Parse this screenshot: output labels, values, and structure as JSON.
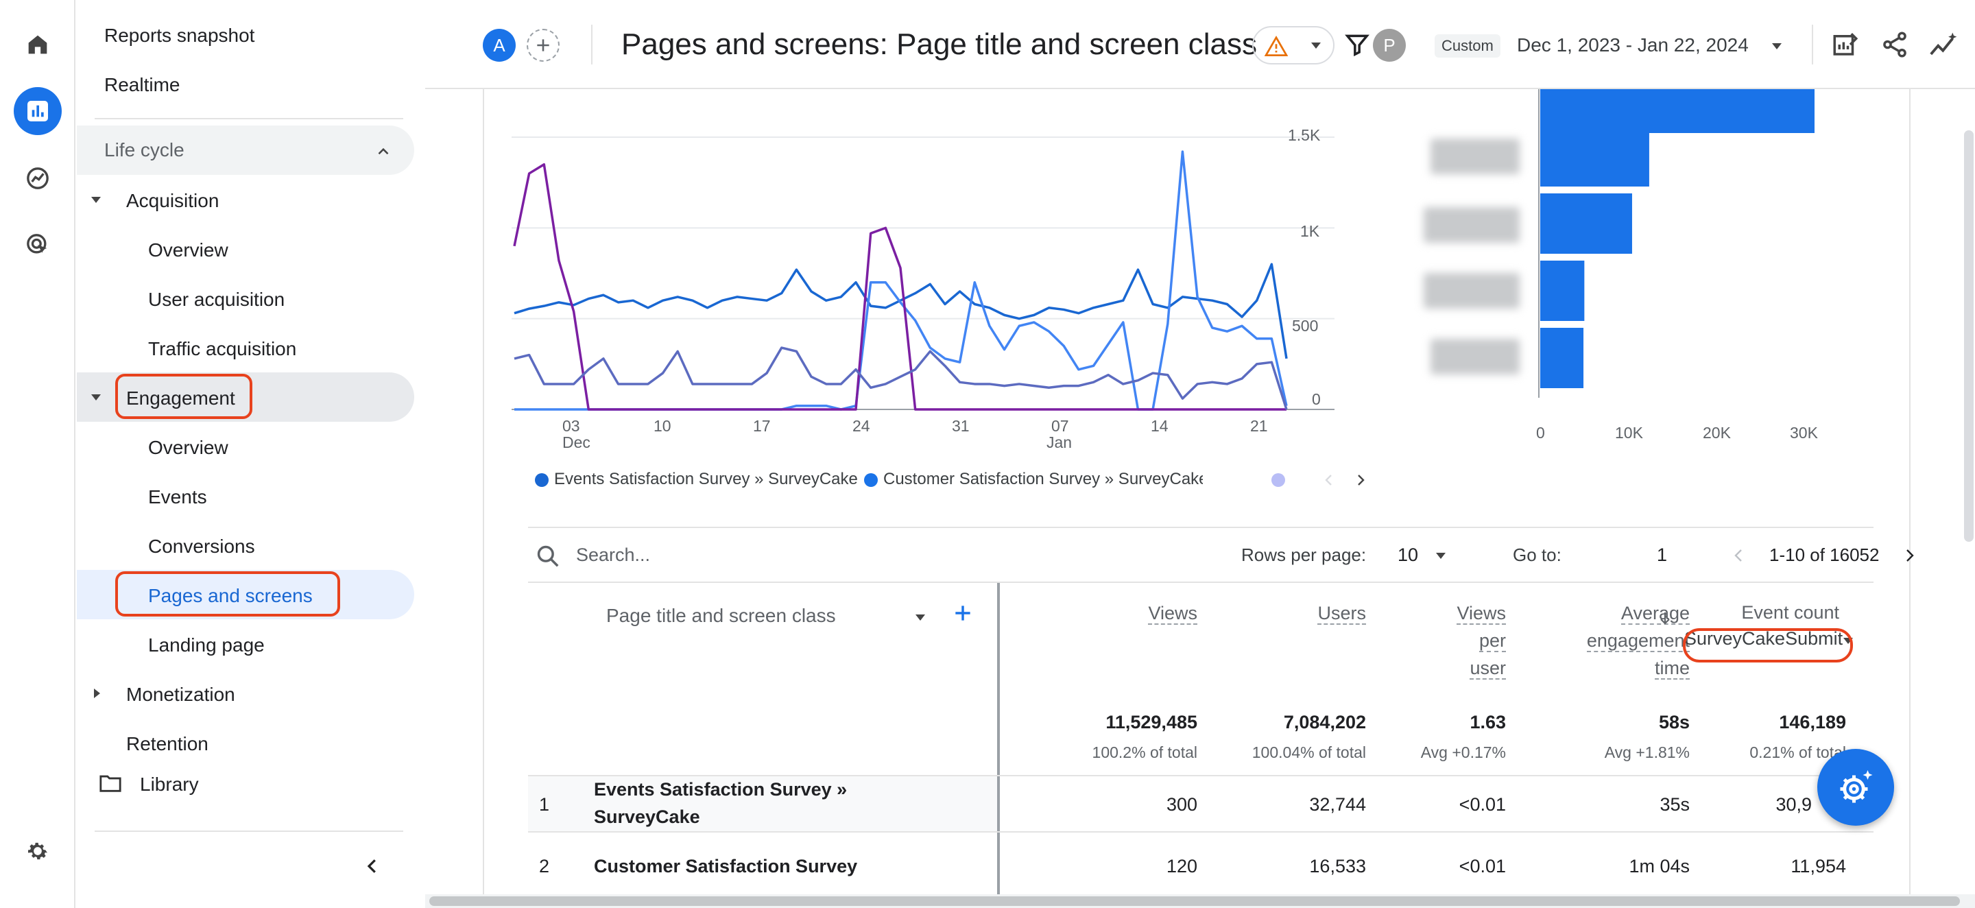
{
  "topbar": {
    "avatar_a": "A",
    "title": "Pages and screens: Page title and screen class",
    "avatar_p": "P",
    "date_mode": "Custom",
    "date_range": "Dec 1, 2023 - Jan 22, 2024"
  },
  "nav": {
    "reports_snapshot": "Reports snapshot",
    "realtime": "Realtime",
    "lifecycle": "Life cycle",
    "acquisition": "Acquisition",
    "acq_overview": "Overview",
    "user_acquisition": "User acquisition",
    "traffic_acquisition": "Traffic acquisition",
    "engagement": "Engagement",
    "eng_overview": "Overview",
    "events": "Events",
    "conversions": "Conversions",
    "pages_and_screens": "Pages and screens",
    "landing_page": "Landing page",
    "monetization": "Monetization",
    "retention": "Retention",
    "library": "Library"
  },
  "chart_data": [
    {
      "type": "line",
      "x_tick_labels": [
        "03",
        "10",
        "17",
        "24",
        "31",
        "07",
        "14",
        "21"
      ],
      "x_sub_labels": [
        "Dec",
        "Jan"
      ],
      "y_tick_labels": [
        "0",
        "500",
        "1K",
        "1.5K"
      ],
      "ylim": [
        0,
        1500
      ],
      "x": [
        "Dec 1",
        "Dec 2",
        "Dec 3",
        "Dec 4",
        "Dec 5",
        "Dec 6",
        "Dec 7",
        "Dec 8",
        "Dec 9",
        "Dec 10",
        "Dec 11",
        "Dec 12",
        "Dec 13",
        "Dec 14",
        "Dec 15",
        "Dec 16",
        "Dec 17",
        "Dec 18",
        "Dec 19",
        "Dec 20",
        "Dec 21",
        "Dec 22",
        "Dec 23",
        "Dec 24",
        "Dec 25",
        "Dec 26",
        "Dec 27",
        "Dec 28",
        "Dec 29",
        "Dec 30",
        "Dec 31",
        "Jan 1",
        "Jan 2",
        "Jan 3",
        "Jan 4",
        "Jan 5",
        "Jan 6",
        "Jan 7",
        "Jan 8",
        "Jan 9",
        "Jan 10",
        "Jan 11",
        "Jan 12",
        "Jan 13",
        "Jan 14",
        "Jan 15",
        "Jan 16",
        "Jan 17",
        "Jan 18",
        "Jan 19",
        "Jan 20",
        "Jan 21",
        "Jan 22"
      ],
      "series": [
        {
          "name": "Events Satisfaction Survey » SurveyCake",
          "color": "#1967d2",
          "values": [
            530,
            555,
            570,
            590,
            575,
            610,
            630,
            590,
            600,
            560,
            600,
            620,
            600,
            560,
            600,
            620,
            610,
            600,
            640,
            770,
            650,
            600,
            620,
            700,
            570,
            560,
            600,
            640,
            690,
            580,
            650,
            580,
            560,
            520,
            500,
            520,
            560,
            550,
            530,
            560,
            580,
            600,
            770,
            580,
            560,
            620,
            610,
            600,
            580,
            510,
            600,
            800,
            280
          ]
        },
        {
          "name": "Customer Satisfaction Survey » SurveyCake",
          "color": "#4285f4",
          "values": [
            0,
            0,
            0,
            0,
            0,
            0,
            0,
            0,
            0,
            0,
            0,
            0,
            0,
            0,
            0,
            0,
            0,
            0,
            0,
            20,
            20,
            20,
            0,
            20,
            700,
            700,
            590,
            490,
            340,
            280,
            260,
            700,
            460,
            330,
            460,
            480,
            430,
            350,
            220,
            240,
            360,
            480,
            0,
            0,
            470,
            1420,
            620,
            450,
            430,
            460,
            390,
            390,
            20
          ]
        },
        {
          "name": "",
          "color": "#7b1fa2",
          "values": [
            900,
            1300,
            1350,
            820,
            540,
            0,
            0,
            0,
            0,
            0,
            0,
            0,
            0,
            0,
            0,
            0,
            0,
            0,
            0,
            0,
            0,
            0,
            0,
            0,
            970,
            1000,
            780,
            0,
            0,
            0,
            0,
            0,
            0,
            0,
            0,
            0,
            0,
            0,
            0,
            0,
            0,
            0,
            0,
            0,
            0,
            0,
            0,
            0,
            0,
            0,
            0,
            0,
            0
          ]
        },
        {
          "name": "",
          "color": "#5c6bc0",
          "values": [
            280,
            300,
            140,
            140,
            140,
            220,
            280,
            140,
            140,
            140,
            200,
            320,
            140,
            140,
            140,
            140,
            140,
            200,
            340,
            320,
            180,
            140,
            140,
            220,
            120,
            140,
            180,
            220,
            320,
            240,
            150,
            140,
            140,
            130,
            140,
            130,
            120,
            130,
            130,
            150,
            190,
            140,
            160,
            200,
            190,
            60,
            140,
            150,
            140,
            170,
            250,
            260,
            0
          ]
        }
      ],
      "legend_items": [
        "Events Satisfaction Survey » SurveyCake",
        "Customer Satisfaction Survey » SurveyCake"
      ],
      "legend_colors": [
        "#1967d2",
        "#1a73e8",
        "#b8bdf6"
      ]
    },
    {
      "type": "bar",
      "orientation": "horizontal",
      "values": [
        31000,
        12100,
        10200,
        4900,
        4800
      ],
      "x_tick_labels": [
        "0",
        "10K",
        "20K",
        "30K"
      ],
      "xlim": [
        0,
        35000
      ],
      "color": "#1a73e8"
    }
  ],
  "table": {
    "search_placeholder": "Search...",
    "rows_per_page_label": "Rows per page:",
    "rows_per_page": "10",
    "goto_label": "Go to:",
    "goto_value": "1",
    "range": "1-10 of 16052",
    "dim_header": "Page title and screen class",
    "columns": {
      "views": "Views",
      "users": "Users",
      "vpu1": "Views",
      "vpu2": "per",
      "vpu3": "user",
      "aet1": "Average",
      "aet2": "engagement",
      "aet3": "time",
      "event_count": "Event count",
      "event_filter": "SurveyCakeSubmit"
    },
    "totals": {
      "views": "11,529,485",
      "views_sub": "100.2% of total",
      "users": "7,084,202",
      "users_sub": "100.04% of total",
      "vpu": "1.63",
      "vpu_sub": "Avg +0.17%",
      "aet": "58s",
      "aet_sub": "Avg +1.81%",
      "events": "146,189",
      "events_sub": "0.21% of total"
    },
    "rows": [
      {
        "n": "1",
        "name1": "Events Satisfaction Survey »",
        "name2": "SurveyCake",
        "views": "300",
        "users": "32,744",
        "vpu": "<0.01",
        "aet": "35s",
        "events": "30,9"
      },
      {
        "n": "2",
        "name1": "Customer Satisfaction Survey",
        "name2": "",
        "views": "120",
        "users": "16,533",
        "vpu": "<0.01",
        "aet": "1m 04s",
        "events": "11,954"
      }
    ]
  }
}
